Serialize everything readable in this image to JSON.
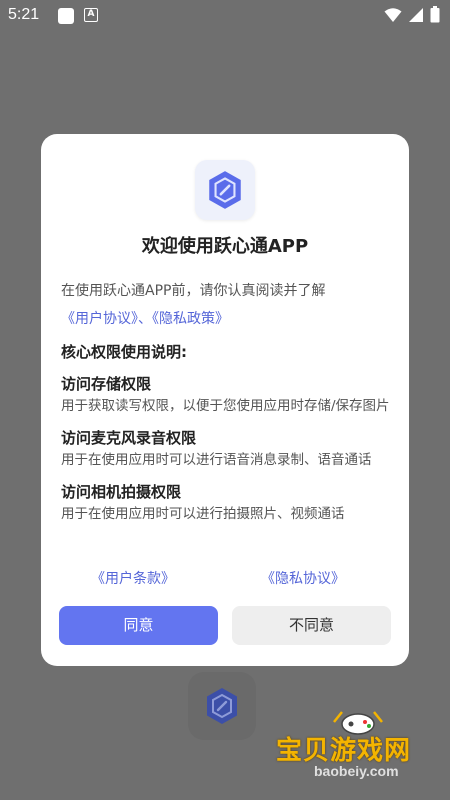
{
  "status_bar": {
    "time": "5:21",
    "notification_badge": "A"
  },
  "dialog": {
    "title": "欢迎使用跃心通APP",
    "intro": "在使用跃心通APP前，请你认真阅读并了解",
    "user_agreement_link": "《用户协议》",
    "link_separator": "、",
    "privacy_policy_link": "《隐私政策》",
    "section_heading": "核心权限使用说明:",
    "permissions": [
      {
        "title": "访问存储权限",
        "desc": "用于获取读写权限，以便于您使用应用时存储/保存图片"
      },
      {
        "title": "访问麦克风录音权限",
        "desc": "用于在使用应用时可以进行语音消息录制、语音通话"
      },
      {
        "title": "访问相机拍摄权限",
        "desc": "用于在使用应用时可以进行拍摄照片、视频通话"
      }
    ],
    "footer_links": {
      "user_terms": "《用户条款》",
      "privacy_agreement": "《隐私协议》"
    },
    "agree_button": "同意",
    "disagree_button": "不同意"
  },
  "watermark": {
    "title": "宝贝游戏网",
    "url": "baobeiy.com"
  },
  "colors": {
    "accent": "#6375f0",
    "link": "#5566d8",
    "overlay": "#6f6f6f"
  },
  "icons": {
    "app_icon": "shield-icon",
    "wifi": "wifi-icon",
    "signal": "signal-icon",
    "battery": "battery-icon"
  }
}
